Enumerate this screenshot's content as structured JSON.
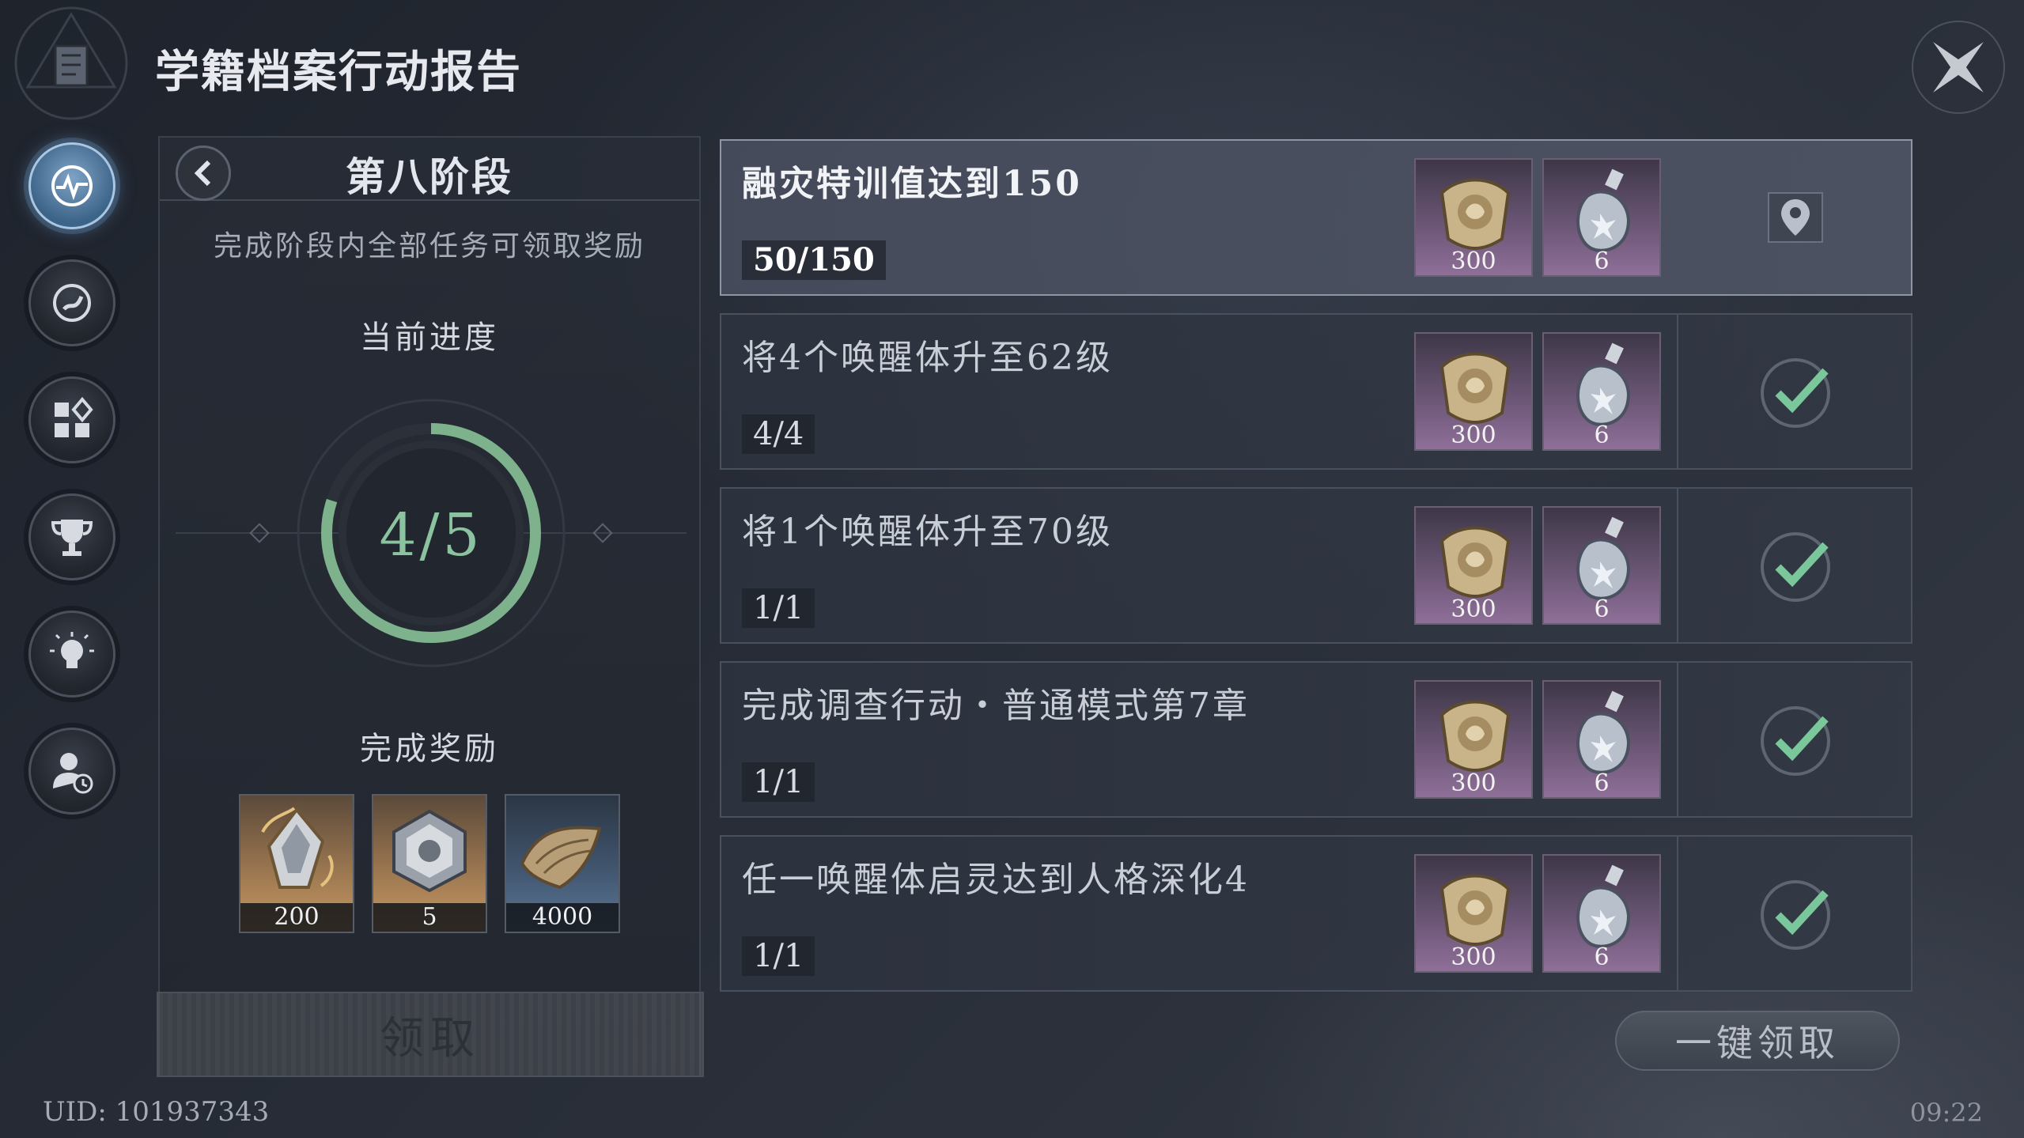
{
  "header": {
    "title": "学籍档案行动报告"
  },
  "sidebar": {
    "items": [
      {
        "icon": "pulse-icon",
        "active": true
      },
      {
        "icon": "refresh-swirl-icon",
        "active": false
      },
      {
        "icon": "grid-apps-icon",
        "active": false
      },
      {
        "icon": "trophy-icon",
        "active": false
      },
      {
        "icon": "lightbulb-icon",
        "active": false
      },
      {
        "icon": "user-clock-icon",
        "active": false
      }
    ]
  },
  "stage": {
    "title": "第八阶段",
    "description": "完成阶段内全部任务可领取奖励",
    "progress_label": "当前进度",
    "progress_text": "4/5",
    "progress_fraction": 0.8,
    "reward_label": "完成奖励",
    "rewards": [
      {
        "icon": "crystal-shard-icon",
        "qty": "200",
        "rarity": "orange"
      },
      {
        "icon": "silver-cube-icon",
        "qty": "5",
        "rarity": "orange"
      },
      {
        "icon": "book-pile-icon",
        "qty": "4000",
        "rarity": "blue"
      }
    ],
    "claim_label": "领取"
  },
  "tasks": [
    {
      "name": "融灾特训值达到150",
      "progress": "50/150",
      "rewards": [
        {
          "icon": "rose-emblem-icon",
          "qty": "300"
        },
        {
          "icon": "potion-bottle-icon",
          "qty": "6"
        }
      ],
      "status": "locate",
      "highlight": true
    },
    {
      "name": "将4个唤醒体升至62级",
      "progress": "4/4",
      "rewards": [
        {
          "icon": "rose-emblem-icon",
          "qty": "300"
        },
        {
          "icon": "potion-bottle-icon",
          "qty": "6"
        }
      ],
      "status": "done",
      "highlight": false
    },
    {
      "name": "将1个唤醒体升至70级",
      "progress": "1/1",
      "rewards": [
        {
          "icon": "rose-emblem-icon",
          "qty": "300"
        },
        {
          "icon": "potion-bottle-icon",
          "qty": "6"
        }
      ],
      "status": "done",
      "highlight": false
    },
    {
      "name": "完成调查行动・普通模式第7章",
      "progress": "1/1",
      "rewards": [
        {
          "icon": "rose-emblem-icon",
          "qty": "300"
        },
        {
          "icon": "potion-bottle-icon",
          "qty": "6"
        }
      ],
      "status": "done",
      "highlight": false
    },
    {
      "name": "任一唤醒体启灵达到人格深化4",
      "progress": "1/1",
      "rewards": [
        {
          "icon": "rose-emblem-icon",
          "qty": "300"
        },
        {
          "icon": "potion-bottle-icon",
          "qty": "6"
        }
      ],
      "status": "done",
      "highlight": false
    }
  ],
  "footer": {
    "claim_all_label": "一键领取",
    "uid": "UID: 101937343",
    "time": "09:22"
  },
  "colors": {
    "progress_ring": "#7db28d",
    "check": "#79c79a",
    "active_nav": "#6f97bf"
  }
}
